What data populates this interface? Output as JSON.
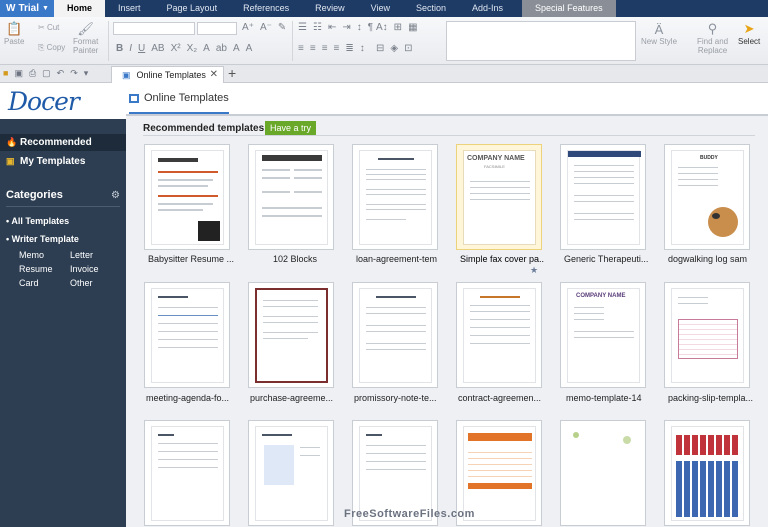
{
  "titlebar": {
    "app_button": "Trial",
    "menu": [
      "Home",
      "Insert",
      "Page Layout",
      "References",
      "Review",
      "View",
      "Section",
      "Add-Ins",
      "Special Features"
    ],
    "active_menu": "Home"
  },
  "ribbon": {
    "paste": "Paste",
    "cut": "Cut",
    "copy": "Copy",
    "format_painter_1": "Format",
    "format_painter_2": "Painter",
    "new_style": "New Style",
    "find_replace_1": "Find and",
    "find_replace_2": "Replace",
    "select": "Select"
  },
  "tabbar": {
    "doc_tab": "Online Templates"
  },
  "sidebar": {
    "logo": "Docer",
    "recommended": "Recommended",
    "my_templates": "My Templates",
    "categories": "Categories",
    "all_templates": "All Templates",
    "writer_template": "Writer Template",
    "subcats": [
      "Memo",
      "Letter",
      "Resume",
      "Invoice",
      "Card",
      "Other"
    ]
  },
  "main": {
    "tab": "Online Templates",
    "recommended_title": "Recommended templates",
    "have_try": "Have a try",
    "templates": [
      "Babysitter Resume ...",
      "102 Blocks",
      "loan-agreement-tem",
      "Simple fax cover pa...",
      "Generic Therapeuti...",
      "dogwalking log sam",
      "meeting-agenda-fo...",
      "purchase-agreeme...",
      "promissory-note-te...",
      "contract-agreemen...",
      "memo-template-14",
      "packing-slip-templa..."
    ]
  },
  "card_text": {
    "company_name": "COMPANY NAME",
    "buddy": "BUDDY",
    "fax": "FACSIMILE"
  },
  "watermark": "FreeSoftwareFiles.com"
}
